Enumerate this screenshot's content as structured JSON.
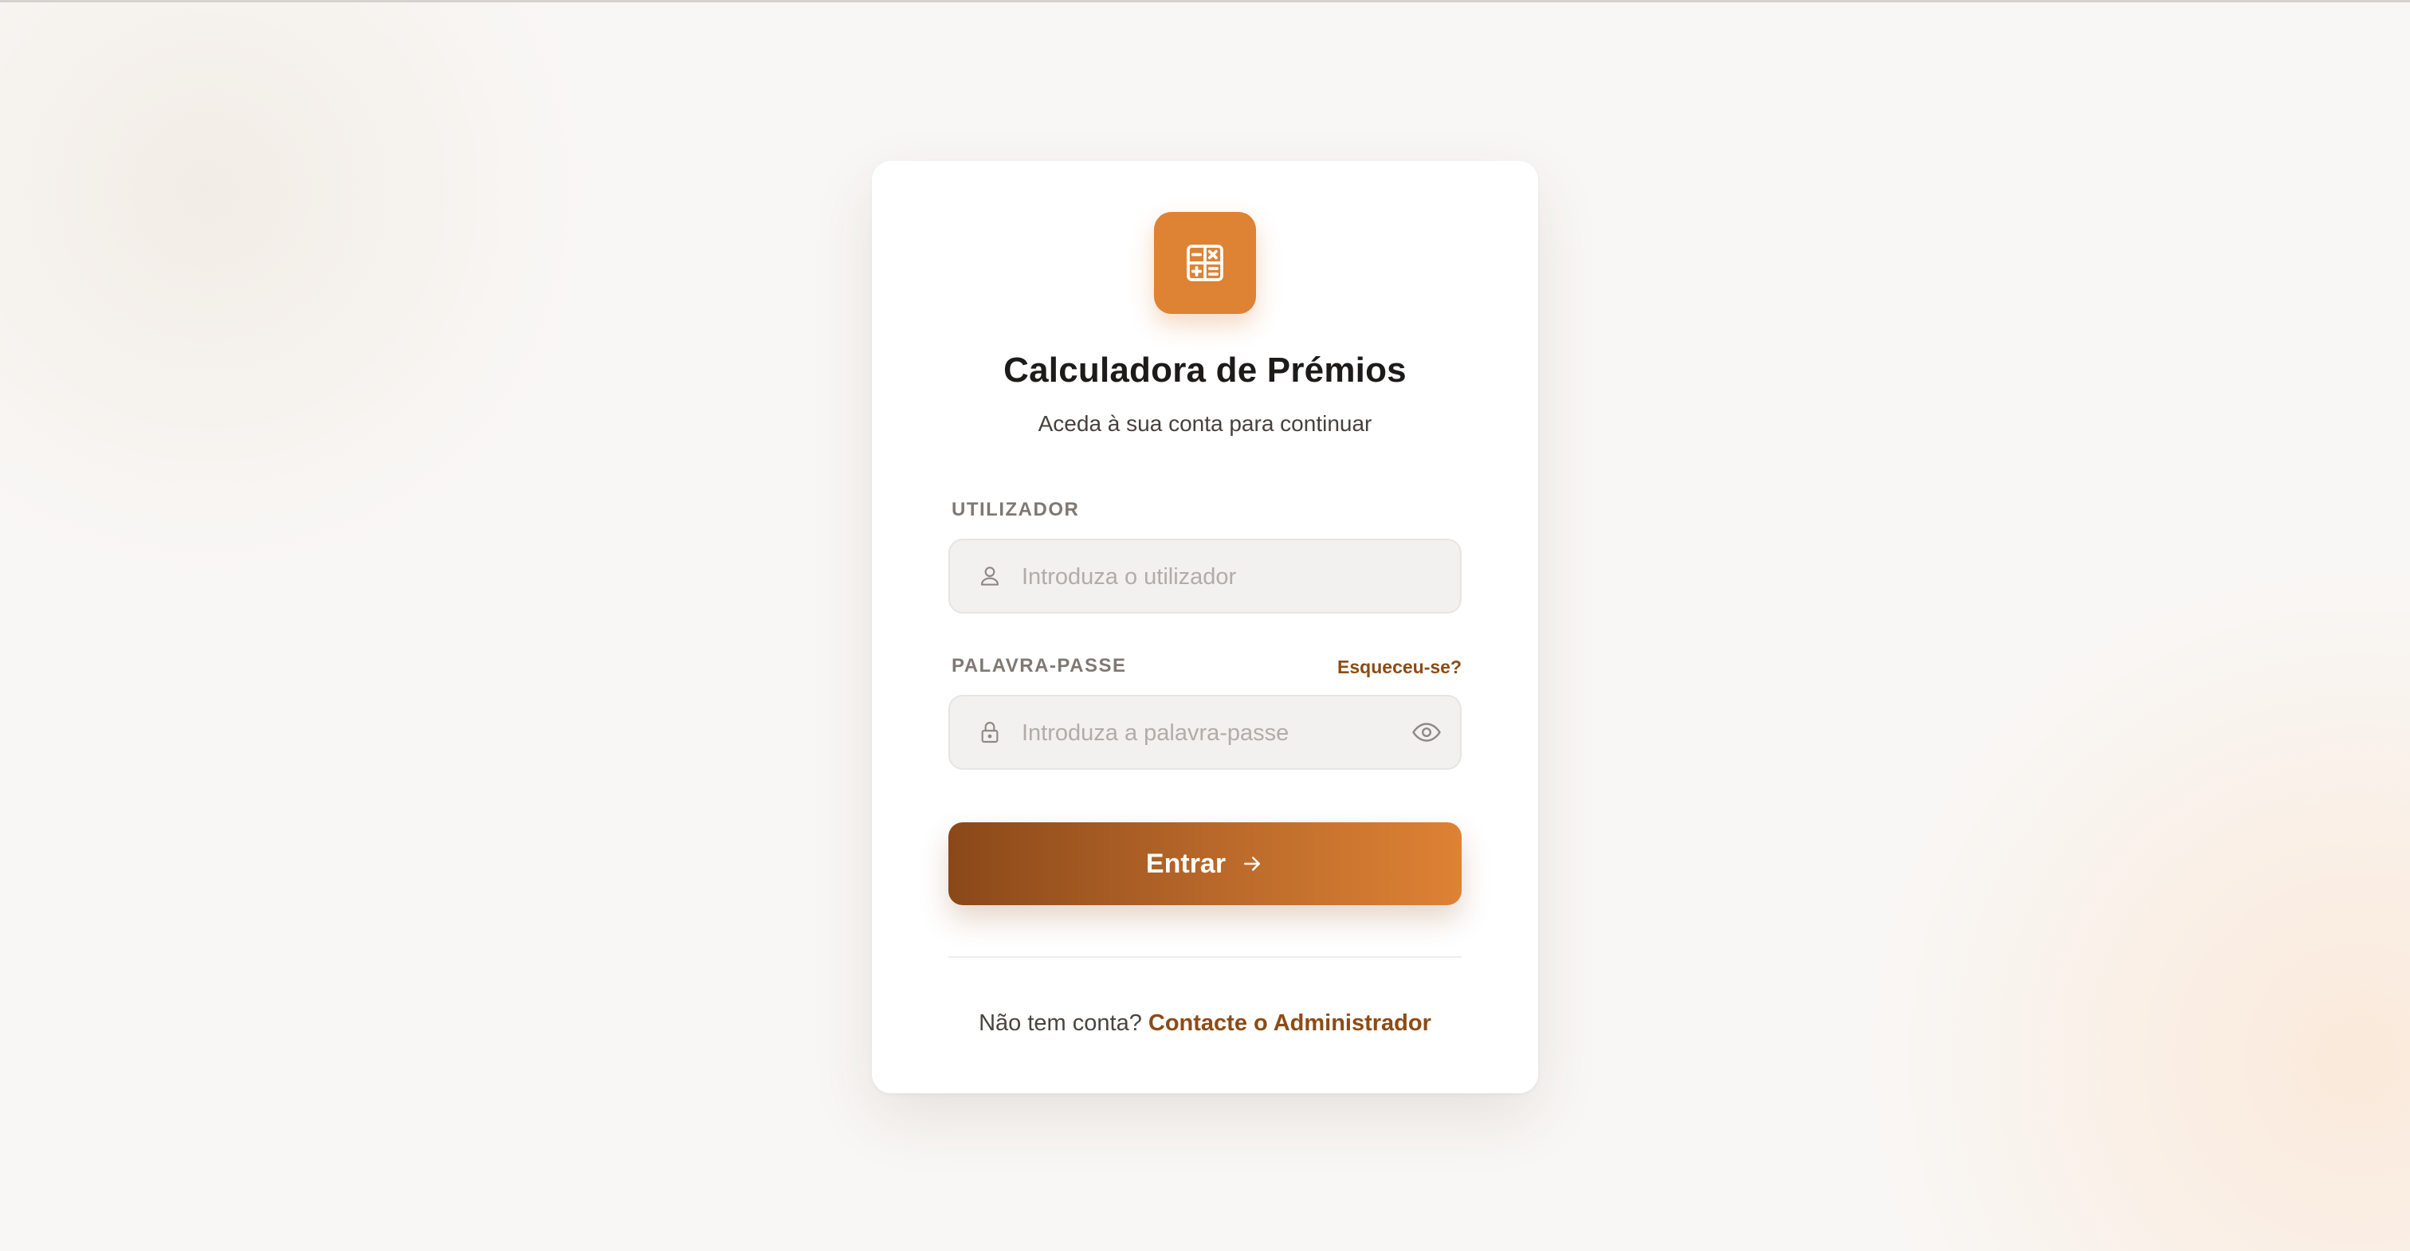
{
  "app": {
    "title": "Calculadora de Prémios",
    "subtitle": "Aceda à sua conta para continuar",
    "logo_icon": "calculator-icon",
    "accent_color": "#de8234",
    "accent_dark": "#8a4819"
  },
  "form": {
    "username": {
      "label": "UTILIZADOR",
      "placeholder": "Introduza o utilizador",
      "value": "",
      "icon": "user-icon"
    },
    "password": {
      "label": "PALAVRA-PASSE",
      "placeholder": "Introduza a palavra-passe",
      "value": "",
      "icon": "lock-icon",
      "toggle_icon": "eye-icon",
      "forgot_label": "Esqueceu-se?"
    },
    "submit": {
      "label": "Entrar",
      "icon": "arrow-right-icon"
    }
  },
  "footer": {
    "prompt": "Não tem conta?",
    "link": "Contacte o Administrador"
  }
}
